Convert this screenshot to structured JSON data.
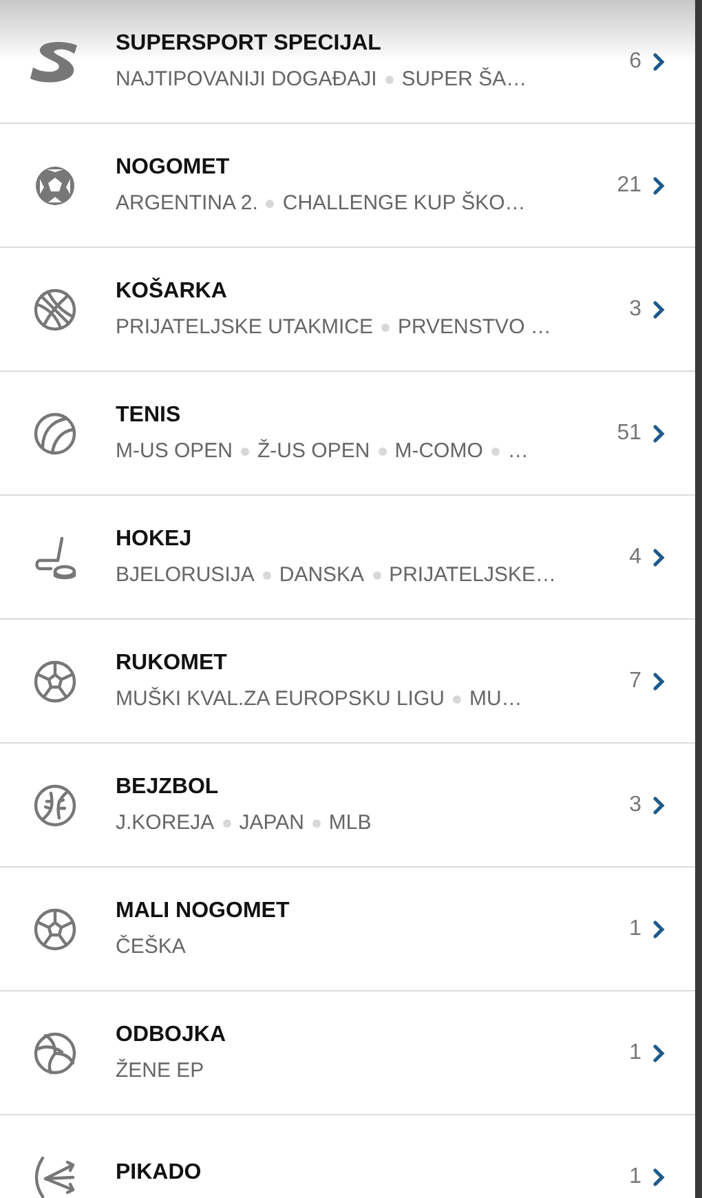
{
  "sports": [
    {
      "kind": "supersport",
      "name": "SUPERSPORT SPECIJAL",
      "leagues": [
        "NAJTIPOVANIJI DOGAĐAJI",
        "SUPER ŠA…"
      ],
      "count": "6"
    },
    {
      "kind": "football",
      "name": "NOGOMET",
      "leagues": [
        "ARGENTINA 2.",
        "CHALLENGE KUP ŠKO…"
      ],
      "count": "21"
    },
    {
      "kind": "basketball",
      "name": "KOŠARKA",
      "leagues": [
        "PRIJATELJSKE UTAKMICE",
        "PRVENSTVO …"
      ],
      "count": "3"
    },
    {
      "kind": "tennis",
      "name": "TENIS",
      "leagues": [
        "M-US OPEN",
        "Ž-US OPEN",
        "M-COMO",
        "…"
      ],
      "count": "51"
    },
    {
      "kind": "hockey",
      "name": "HOKEJ",
      "leagues": [
        "BJELORUSIJA",
        "DANSKA",
        "PRIJATELJSKE…"
      ],
      "count": "4"
    },
    {
      "kind": "handball",
      "name": "RUKOMET",
      "leagues": [
        "MUŠKI KVAL.ZA EUROPSKU LIGU",
        "MU…"
      ],
      "count": "7"
    },
    {
      "kind": "baseball",
      "name": "BEJZBOL",
      "leagues": [
        "J.KOREJA",
        "JAPAN",
        "MLB"
      ],
      "count": "3"
    },
    {
      "kind": "futsal",
      "name": "MALI NOGOMET",
      "leagues": [
        "ČEŠKA"
      ],
      "count": "1"
    },
    {
      "kind": "volleyball",
      "name": "ODBOJKA",
      "leagues": [
        "ŽENE EP"
      ],
      "count": "1"
    },
    {
      "kind": "darts",
      "name": "PIKADO",
      "count": "1"
    }
  ]
}
